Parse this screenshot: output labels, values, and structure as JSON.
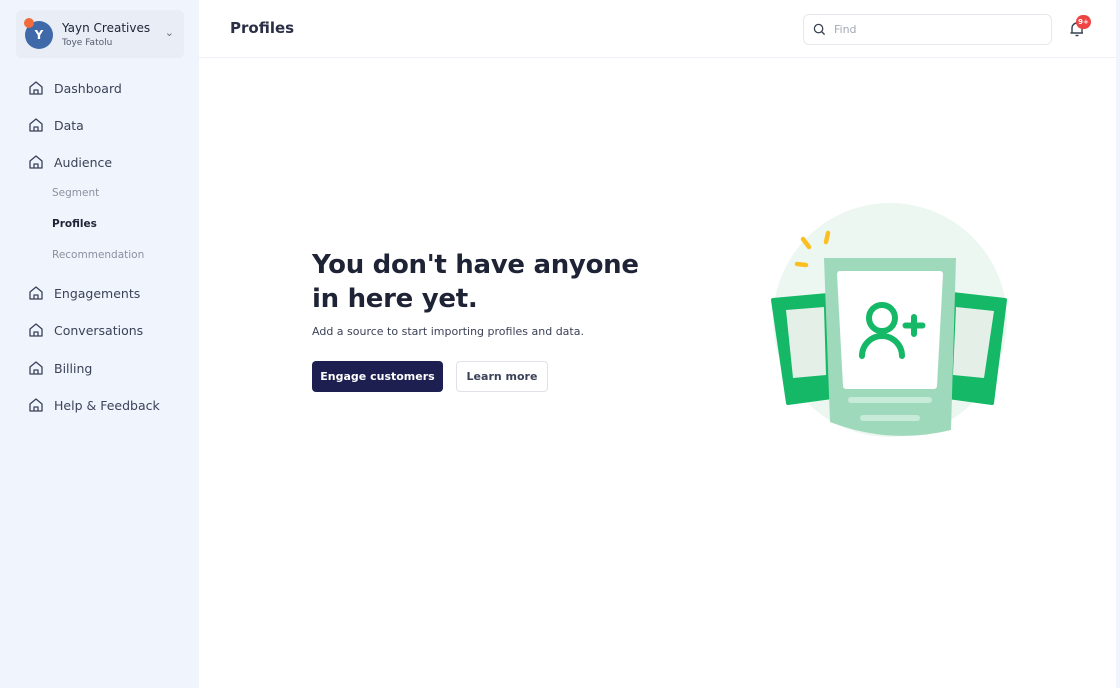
{
  "org": {
    "initial": "Y",
    "name": "Yayn Creatives",
    "user": "Toye Fatolu"
  },
  "nav": [
    {
      "label": "Dashboard"
    },
    {
      "label": "Data"
    },
    {
      "label": "Audience"
    },
    {
      "label": "Engagements"
    },
    {
      "label": "Conversations"
    },
    {
      "label": "Billing"
    },
    {
      "label": "Help & Feedback"
    }
  ],
  "audience_sub": [
    {
      "label": "Segment"
    },
    {
      "label": "Profiles",
      "active": true
    },
    {
      "label": "Recommendation"
    }
  ],
  "header": {
    "title": "Profiles",
    "search_placeholder": "Find",
    "notification_badge": "9+"
  },
  "empty_state": {
    "heading": "You don't have anyone in here yet.",
    "description": "Add a source to start importing profiles and data.",
    "primary_button": "Engage customers",
    "secondary_button": "Learn more"
  },
  "colors": {
    "primary": "#1c1f4f",
    "accent_green": "#14b866",
    "badge": "#ef4444"
  }
}
